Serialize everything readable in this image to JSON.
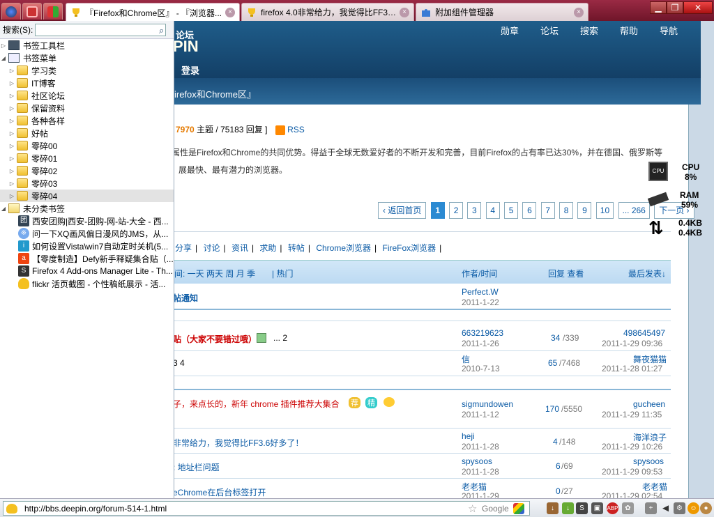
{
  "window": {
    "tabs": [
      {
        "title": "『Firefox和Chrome区』 - 『浏览器...",
        "active": true
      },
      {
        "title": "firefox 4.0非常给力，我觉得比FF3.6...",
        "active": false
      },
      {
        "title": "附加组件管理器",
        "active": false
      }
    ],
    "controls": {
      "minimize": "▁",
      "maximize": "❐",
      "close": "✕"
    }
  },
  "sidebar": {
    "search_label": "搜索(S):",
    "search_value": "",
    "toolbar_folder": "书签工具栏",
    "menu_folder": "书签菜单",
    "menu_items": [
      "学习类",
      "IT博客",
      "社区论坛",
      "保留资料",
      "各种各样",
      "好帖",
      "零碎00",
      "零碎01",
      "零碎02",
      "零碎03",
      "零碎04"
    ],
    "unsorted_folder": "未分类书签",
    "unsorted_items": [
      "西安团购|西安-团购-网-站-大全 - 西...",
      "问一下XQ画风偏日漫风的JMS，从...",
      "如何设置Vista\\win7自动定时关机(5...",
      "【零度制造】Defy新手释疑集合贴（...",
      "Firefox 4 Add-ons Manager Lite - Th...",
      "flickr 活页截图 - 个性稿纸展示 - 活..."
    ]
  },
  "page": {
    "logo_top": "论坛",
    "logo_main": "PIN",
    "nav": [
      "勋章",
      "论坛",
      "搜索",
      "帮助",
      "导航"
    ],
    "login": "登录",
    "breadcrumb": "irefox和Chrome区』",
    "stats": {
      "topics": "7970",
      "topics_label": "主题 /",
      "replies": "75183",
      "replies_label": "回复 ]",
      "rss": "RSS"
    },
    "desc_line1": "属性是Firefox和Chrome的共同优势。得益于全球无数爱好者的不断开发和完善，目前Firefox的占有率已达30%，并在德国、俄罗斯等",
    "desc_line2": "展最快、最有潜力的浏览器。",
    "pager": {
      "back": "返回首页",
      "pages": [
        "1",
        "2",
        "3",
        "4",
        "5",
        "6",
        "7",
        "8",
        "9",
        "10",
        "... 266"
      ],
      "next": "下一页"
    },
    "subnav": [
      "分享",
      "讨论",
      "资讯",
      "求助",
      "转帖",
      "Chrome浏览器",
      "FireFox浏览器"
    ],
    "thead": {
      "filter": "间: 一天 两天 周 月 季",
      "hot": "热门",
      "author": "作者/时间",
      "replies": "回复 查看",
      "last": "最后发表↓"
    },
    "rows": [
      {
        "title": "帖通知",
        "author": "Perfect.W",
        "date": "2011-1-22",
        "rv": "",
        "views": "",
        "last": "",
        "ldate": ""
      },
      {
        "title": "贴（大家不要错过哦）",
        "pages": "... 2",
        "author": "663219623",
        "date": "2011-1-26",
        "rv": "34",
        "views": "339",
        "last": "498645497",
        "ldate": "2011-1-29 09:36"
      },
      {
        "title": "3   4",
        "author": "信",
        "date": "2010-7-13",
        "rv": "65",
        "views": "7468",
        "last": "舞夜猫猫",
        "ldate": "2011-1-28 01:27"
      },
      {
        "title": "子，来点长的，新年 chrome 插件推荐大集合",
        "author": "sigmundowen",
        "date": "2011-1-12",
        "rv": "170",
        "views": "5550",
        "last": "gucheen",
        "ldate": "2011-1-29 11:35"
      },
      {
        "title": "非常给力，我觉得比FF3.6好多了！",
        "author": "heji",
        "date": "2011-1-28",
        "rv": "4",
        "views": "148",
        "last": "海洋浪子",
        "ldate": "2011-1-29 10:26"
      },
      {
        "title": ": 地址栏问题",
        "author": "spysoos",
        "date": "2011-1-28",
        "rv": "6",
        "views": "69",
        "last": "spysoos",
        "ldate": "2011-1-29 09:53"
      },
      {
        "title": "eChrome在后台标签打开",
        "author": "老老猫",
        "date": "2011-1-29",
        "rv": "0",
        "views": "27",
        "last": "老老猫",
        "ldate": "2011-1-29 02:54"
      }
    ],
    "badges": {
      "recommend": "荐",
      "elite": "精"
    }
  },
  "monitor": {
    "cpu_label": "CPU",
    "cpu": "8%",
    "ram_label": "RAM",
    "ram": "59%",
    "up": "0.4KB",
    "down": "0.4KB"
  },
  "statusbar": {
    "url": "http://bbs.deepin.org/forum-514-1.html",
    "search_engine": "Google"
  }
}
